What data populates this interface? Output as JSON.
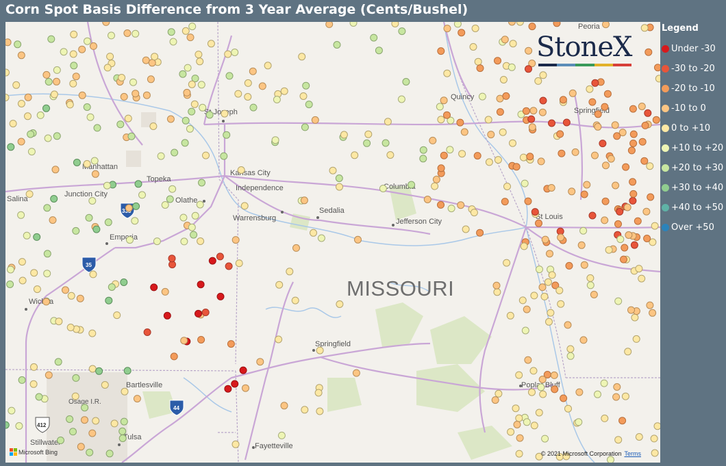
{
  "title": "Corn Spot Basis Difference from 3 Year Average (Cents/Bushel)",
  "legend": {
    "title": "Legend",
    "items": [
      {
        "label": "Under -30",
        "color": "#d7191c"
      },
      {
        "label": "-30 to -20",
        "color": "#e8553a"
      },
      {
        "label": "-20 to -10",
        "color": "#f39b5a"
      },
      {
        "label": "-10 to 0",
        "color": "#fcc583"
      },
      {
        "label": "0 to +10",
        "color": "#fde8a4"
      },
      {
        "label": "+10 to +20",
        "color": "#eef5b4"
      },
      {
        "label": "+20 to +30",
        "color": "#c7e6a0"
      },
      {
        "label": "+30 to +40",
        "color": "#90cd8f"
      },
      {
        "label": "+40 to +50",
        "color": "#5fb2a6"
      },
      {
        "label": "Over +50",
        "color": "#2b83ba"
      }
    ]
  },
  "logo": {
    "text": "StoneX",
    "bar_colors": [
      "#1b2a4a",
      "#5b8db8",
      "#3a9a5a",
      "#e2b12a",
      "#d7403a"
    ]
  },
  "map": {
    "state_label": "MISSOURI",
    "cities": [
      "St Joseph",
      "Manhattan",
      "Topeka",
      "Kansas City",
      "Independence",
      "Junction City",
      "Salina",
      "Olathe",
      "Columbia",
      "Warrensburg",
      "Sedalia",
      "Jefferson City",
      "Emporia",
      "St Louis",
      "Quincy",
      "Springfield",
      "Peoria",
      "Wichita",
      "Springfield",
      "Bartlesville",
      "Osage I.R.",
      "Poplar Bluff",
      "Stillwater",
      "Tulsa",
      "Fayetteville"
    ],
    "shields": [
      "335",
      "35",
      "44",
      "412"
    ],
    "attribution": {
      "bing": "Microsoft Bing",
      "copyright": "© 2021 Microsoft Corporation",
      "terms": "Terms"
    }
  }
}
